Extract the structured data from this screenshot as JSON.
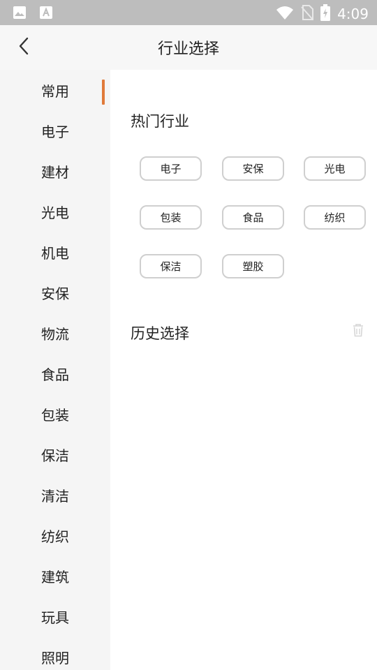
{
  "status_bar": {
    "time": "4:09",
    "icons": [
      "image-icon",
      "notification-icon",
      "wifi-icon",
      "no-sim-icon",
      "battery-charging-icon"
    ]
  },
  "header": {
    "title": "行业选择",
    "back_icon": "back-arrow-icon"
  },
  "sidebar": {
    "active_index": 0,
    "items": [
      {
        "label": "常用"
      },
      {
        "label": "电子"
      },
      {
        "label": "建材"
      },
      {
        "label": "光电"
      },
      {
        "label": "机电"
      },
      {
        "label": "安保"
      },
      {
        "label": "物流"
      },
      {
        "label": "食品"
      },
      {
        "label": "包装"
      },
      {
        "label": "保洁"
      },
      {
        "label": "清洁"
      },
      {
        "label": "纺织"
      },
      {
        "label": "建筑"
      },
      {
        "label": "玩具"
      },
      {
        "label": "照明"
      }
    ]
  },
  "main": {
    "hot_title": "热门行业",
    "hot_items": [
      "电子",
      "安保",
      "光电",
      "包装",
      "食品",
      "纺织",
      "保洁",
      "塑胶"
    ],
    "history_title": "历史选择",
    "clear_icon": "trash-icon"
  },
  "colors": {
    "accent": "#e07a3a",
    "status_bar": "#bdbdbd",
    "sidebar_bg": "#f5f5f5",
    "chip_border": "#cfcfcf"
  }
}
